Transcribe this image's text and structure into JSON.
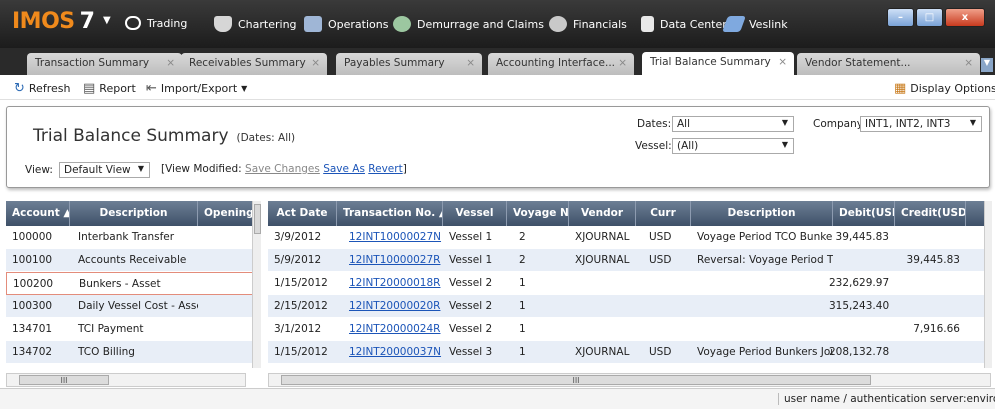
{
  "app": {
    "logo": "IMOS",
    "version": "7"
  },
  "nav": [
    "Trading",
    "Chartering",
    "Operations",
    "Demurrage and Claims",
    "Financials",
    "Data Center",
    "Veslink"
  ],
  "window_controls": {
    "minimize": "–",
    "maximize": "□",
    "close": "x"
  },
  "tabs": [
    "Transaction Summary",
    "Receivables Summary",
    "Payables Summary",
    "Accounting Interface...",
    "Trial Balance Summary",
    "Vendor Statement..."
  ],
  "active_tab": 4,
  "toolbar": {
    "refresh": "Refresh",
    "report": "Report",
    "import_export": "Import/Export",
    "display_options": "Display Options"
  },
  "filters": {
    "title": "Trial Balance Summary",
    "subtitle": "(Dates: All)",
    "dates_label": "Dates:",
    "dates_value": "All",
    "vessel_label": "Vessel:",
    "vessel_value": "(All)",
    "company_label": "Company:",
    "company_value": "INT1, INT2, INT3",
    "view_label": "View:",
    "view_value": "Default View",
    "view_modified": "[View Modified:",
    "save_changes": "Save Changes",
    "save_as": "Save As",
    "revert": "Revert",
    "close_bracket": "]"
  },
  "left_grid": {
    "headers": [
      "Account ▲",
      "Description",
      "Opening B"
    ],
    "rows": [
      {
        "account": "100000",
        "description": "Interbank Transfer"
      },
      {
        "account": "100100",
        "description": "Accounts Receivable"
      },
      {
        "account": "100200",
        "description": "Bunkers - Asset"
      },
      {
        "account": "100300",
        "description": "Daily Vessel Cost - Asset"
      },
      {
        "account": "134701",
        "description": "TCI Payment"
      },
      {
        "account": "134702",
        "description": "TCO Billing"
      }
    ]
  },
  "right_grid": {
    "headers": [
      "Act Date",
      "Transaction No. ▲",
      "Vessel",
      "Voyage No.",
      "Vendor",
      "Curr",
      "Description",
      "Debit(USD)",
      "Credit(USD)"
    ],
    "rows": [
      {
        "date": "3/9/2012",
        "trans": "12INT10000027N",
        "vessel": "Vessel 1",
        "voyage": "2",
        "vendor": "XJOURNAL",
        "curr": "USD",
        "desc": "Voyage Period TCO Bunker Ac",
        "debit": "39,445.83",
        "credit": ""
      },
      {
        "date": "5/9/2012",
        "trans": "12INT10000027R",
        "vessel": "Vessel 1",
        "voyage": "2",
        "vendor": "XJOURNAL",
        "curr": "USD",
        "desc": "Reversal: Voyage Period TCO",
        "debit": "",
        "credit": "39,445.83"
      },
      {
        "date": "1/15/2012",
        "trans": "12INT20000018R",
        "vessel": "Vessel 2",
        "voyage": "1",
        "vendor": "",
        "curr": "",
        "desc": "",
        "debit": "232,629.97",
        "credit": ""
      },
      {
        "date": "2/15/2012",
        "trans": "12INT20000020R",
        "vessel": "Vessel 2",
        "voyage": "1",
        "vendor": "",
        "curr": "",
        "desc": "",
        "debit": "315,243.40",
        "credit": ""
      },
      {
        "date": "3/1/2012",
        "trans": "12INT20000024R",
        "vessel": "Vessel 2",
        "voyage": "1",
        "vendor": "",
        "curr": "",
        "desc": "",
        "debit": "",
        "credit": "7,916.66"
      },
      {
        "date": "1/15/2012",
        "trans": "12INT20000037N",
        "vessel": "Vessel 3",
        "voyage": "1",
        "vendor": "XJOURNAL",
        "curr": "USD",
        "desc": "Voyage Period Bunkers Journ",
        "debit": "208,132.78",
        "credit": ""
      }
    ]
  },
  "status_bar": "user name / authentication server:environment",
  "scroll_grip": "III"
}
